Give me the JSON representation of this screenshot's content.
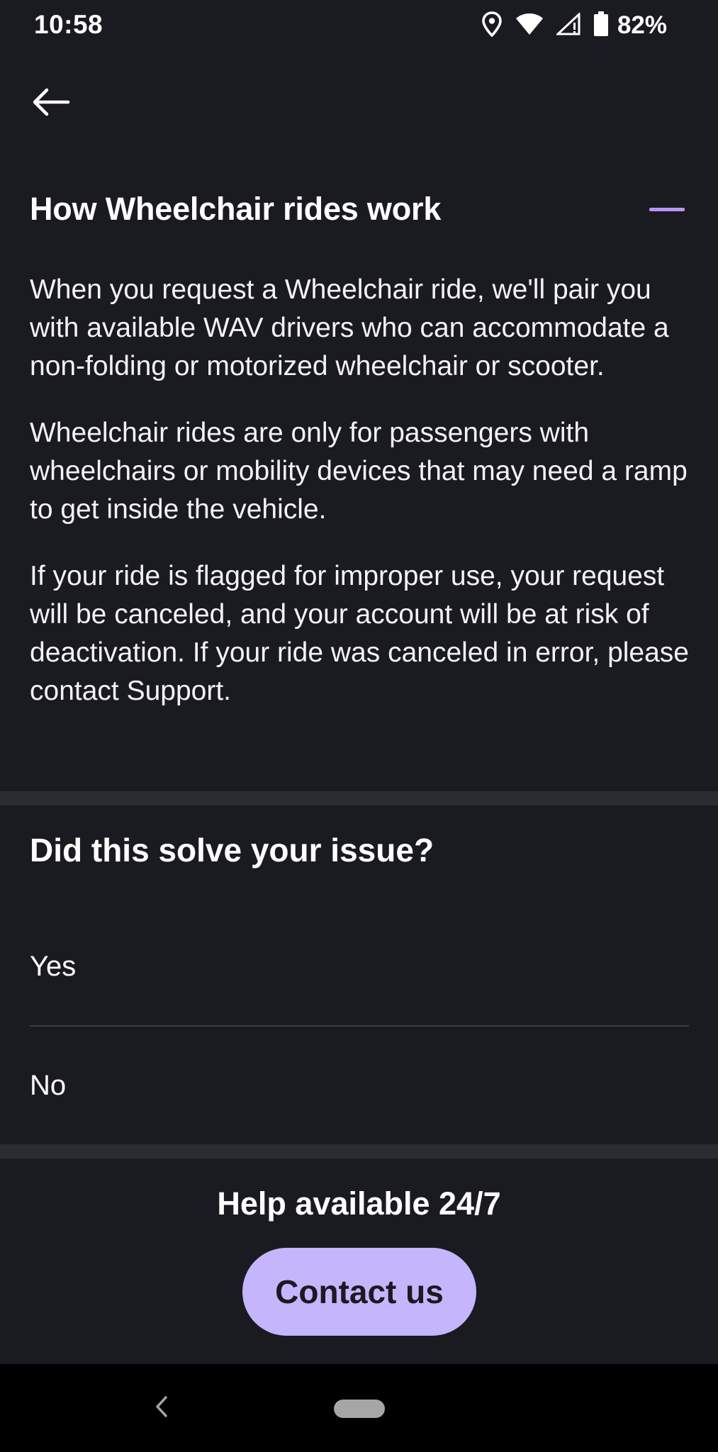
{
  "status_bar": {
    "time": "10:58",
    "battery_percent": "82%",
    "icons": [
      "location-icon",
      "wifi-icon",
      "signal-icon",
      "battery-icon"
    ]
  },
  "nav": {
    "back_icon": "arrow-left-icon"
  },
  "article": {
    "title": "How Wheelchair rides work",
    "toggle_icon": "collapse-minus-icon",
    "paragraphs": [
      "When you request a Wheelchair ride, we'll pair you with available WAV drivers who can accommodate a non-folding or motorized wheelchair or scooter.",
      "Wheelchair rides are only for passengers with wheelchairs or mobility devices that may need a ramp to get inside the vehicle.",
      "If your ride is flagged for improper use, your request will be canceled, and your account will be at risk of deactivation. If your ride was canceled in error, please contact Support."
    ]
  },
  "feedback": {
    "question": "Did this solve your issue?",
    "options": [
      "Yes",
      "No"
    ]
  },
  "help": {
    "title": "Help available 24/7",
    "contact_label": "Contact us"
  },
  "colors": {
    "background": "#1a1a21",
    "divider_band": "#2b2c33",
    "accent": "#b794f6",
    "button": "#c4b5fd"
  },
  "system_nav": {
    "back_icon": "chevron-left-icon",
    "home_icon": "home-pill-icon"
  }
}
